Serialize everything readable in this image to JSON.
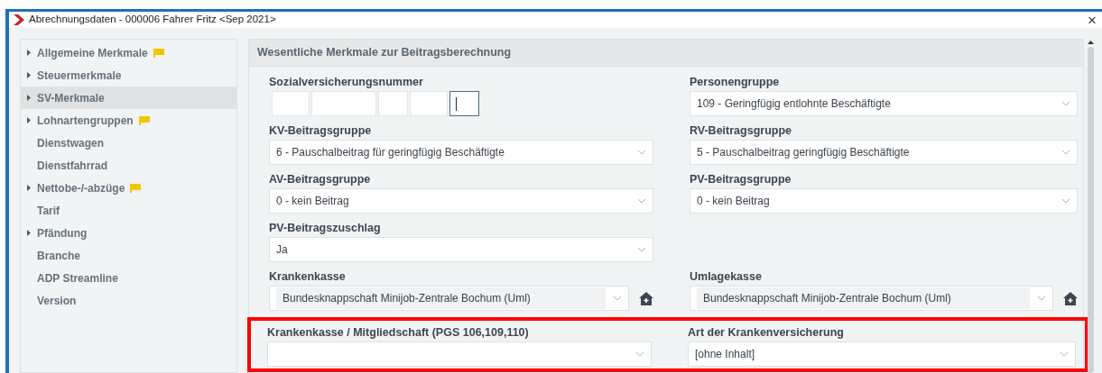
{
  "window": {
    "title": "Abrechnungsdaten - 000006 Fahrer Fritz <Sep 2021>",
    "close": "×"
  },
  "sidebar": {
    "items": [
      {
        "label": "Allgemeine Merkmale",
        "expandable": true,
        "flagged": true,
        "selected": false
      },
      {
        "label": "Steuermerkmale",
        "expandable": true,
        "flagged": false,
        "selected": false
      },
      {
        "label": "SV-Merkmale",
        "expandable": true,
        "flagged": false,
        "selected": true
      },
      {
        "label": "Lohnartengruppen",
        "expandable": true,
        "flagged": true,
        "selected": false
      },
      {
        "label": "Dienstwagen",
        "expandable": false,
        "flagged": false,
        "selected": false
      },
      {
        "label": "Dienstfahrrad",
        "expandable": false,
        "flagged": false,
        "selected": false
      },
      {
        "label": "Nettobe-/-abzüge",
        "expandable": true,
        "flagged": true,
        "selected": false
      },
      {
        "label": "Tarif",
        "expandable": false,
        "flagged": false,
        "selected": false
      },
      {
        "label": "Pfändung",
        "expandable": true,
        "flagged": false,
        "selected": false
      },
      {
        "label": "Branche",
        "expandable": false,
        "flagged": false,
        "selected": false
      },
      {
        "label": "ADP Streamline",
        "expandable": false,
        "flagged": false,
        "selected": false
      },
      {
        "label": "Version",
        "expandable": false,
        "flagged": false,
        "selected": false
      }
    ]
  },
  "panel": {
    "title": "Wesentliche Merkmale zur Beitragsberechnung",
    "rows": [
      {
        "highlighted": false,
        "fields": [
          {
            "kind": "sv-number",
            "label": "Sozialversicherungsnummer",
            "segments": [
              {
                "focused": false
              },
              {
                "focused": false
              },
              {
                "focused": false
              },
              {
                "focused": false
              },
              {
                "focused": true
              }
            ]
          },
          {
            "kind": "select",
            "label": "Personengruppe",
            "value": "109 - Geringfügig entlohnte Beschäftigte"
          }
        ]
      },
      {
        "highlighted": false,
        "fields": [
          {
            "kind": "select",
            "label": "KV-Beitragsgruppe",
            "value": "6 - Pauschalbeitrag für geringfügig Beschäftigte"
          },
          {
            "kind": "select",
            "label": "RV-Beitragsgruppe",
            "value": "5 - Pauschalbeitrag geringfügig Beschäftigte"
          }
        ]
      },
      {
        "highlighted": false,
        "fields": [
          {
            "kind": "select",
            "label": "AV-Beitragsgruppe",
            "value": "0 - kein Beitrag"
          },
          {
            "kind": "select",
            "label": "PV-Beitragsgruppe",
            "value": "0 - kein Beitrag"
          }
        ]
      },
      {
        "highlighted": false,
        "fields": [
          {
            "kind": "select",
            "label": "PV-Beitragszuschlag",
            "value": "Ja"
          }
        ]
      },
      {
        "highlighted": false,
        "fields": [
          {
            "kind": "select-with-button",
            "label": "Krankenkasse",
            "value": "Bundesknappschaft Minijob-Zentrale Bochum (Uml)"
          },
          {
            "kind": "select-with-button",
            "label": "Umlagekasse",
            "value": "Bundesknappschaft Minijob-Zentrale Bochum (Uml)"
          }
        ]
      },
      {
        "highlighted": true,
        "fields": [
          {
            "kind": "select",
            "label": "Krankenkasse / Mitgliedschaft (PGS 106,109,110)"
          },
          {
            "kind": "select",
            "label": "Art der Krankenversicherung",
            "value": "[ohne Inhalt]"
          }
        ]
      }
    ]
  }
}
